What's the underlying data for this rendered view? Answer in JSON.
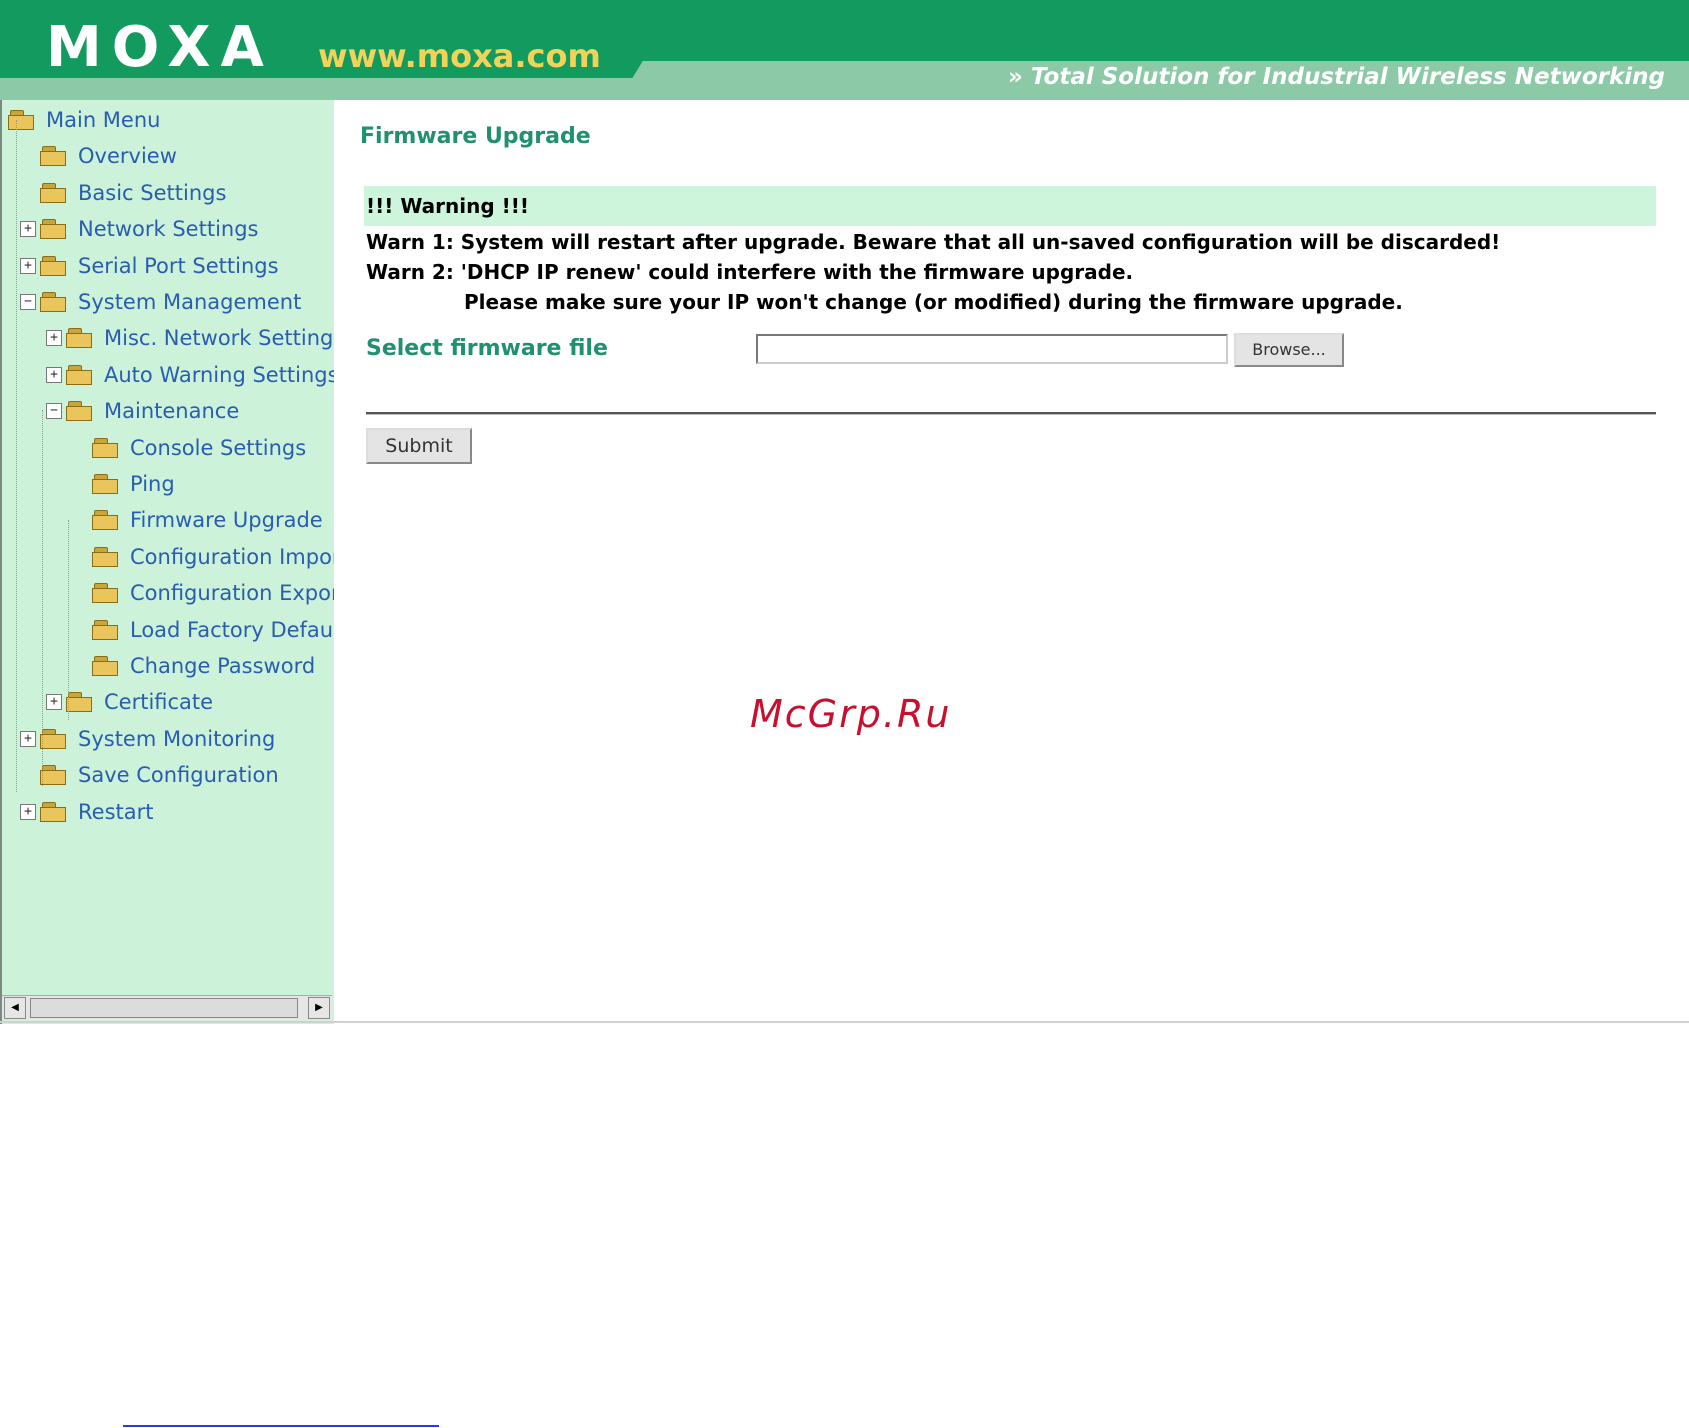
{
  "header": {
    "logo": "MOXA",
    "url": "www.moxa.com",
    "tagline_icon": "double-chevron-icon",
    "tagline": "Total Solution for Industrial Wireless Networking"
  },
  "sidebar": {
    "root": "Main Menu",
    "items": [
      {
        "label": "Overview",
        "depth": 1,
        "toggle": ""
      },
      {
        "label": "Basic Settings",
        "depth": 1,
        "toggle": ""
      },
      {
        "label": "Network Settings",
        "depth": 1,
        "toggle": "+"
      },
      {
        "label": "Serial Port Settings",
        "depth": 1,
        "toggle": "+"
      },
      {
        "label": "System Management",
        "depth": 1,
        "toggle": "-"
      },
      {
        "label": "Misc. Network Settings",
        "depth": 2,
        "toggle": "+"
      },
      {
        "label": "Auto Warning Settings",
        "depth": 2,
        "toggle": "+"
      },
      {
        "label": "Maintenance",
        "depth": 2,
        "toggle": "-"
      },
      {
        "label": "Console Settings",
        "depth": 3,
        "toggle": ""
      },
      {
        "label": "Ping",
        "depth": 3,
        "toggle": ""
      },
      {
        "label": "Firmware Upgrade",
        "depth": 3,
        "toggle": ""
      },
      {
        "label": "Configuration Import",
        "depth": 3,
        "toggle": ""
      },
      {
        "label": "Configuration Export",
        "depth": 3,
        "toggle": ""
      },
      {
        "label": "Load Factory Default",
        "depth": 3,
        "toggle": ""
      },
      {
        "label": "Change Password",
        "depth": 3,
        "toggle": ""
      },
      {
        "label": "Certificate",
        "depth": 2,
        "toggle": "+"
      },
      {
        "label": "System Monitoring",
        "depth": 1,
        "toggle": "+"
      },
      {
        "label": "Save Configuration",
        "depth": 1,
        "toggle": ""
      },
      {
        "label": "Restart",
        "depth": 1,
        "toggle": "+"
      }
    ]
  },
  "main": {
    "title": "Firmware Upgrade",
    "warning_title": "!!! Warning !!!",
    "warn1": "Warn 1: System will restart after upgrade. Beware that all un-saved configuration will be discarded!",
    "warn2": "Warn 2: 'DHCP IP renew' could interfere with the firmware upgrade.",
    "warn2b": "Please make sure your IP won't change (or modified) during the firmware upgrade.",
    "select_label": "Select firmware file",
    "file_value": "",
    "browse_label": "Browse...",
    "submit_label": "Submit"
  },
  "watermark": "McGrp.Ru",
  "colors": {
    "header_dark": "#139a5e",
    "header_light": "#8cc9a6",
    "sidebar_bg": "#ccf2d9",
    "link": "#2a5db0",
    "title_green": "#209070",
    "watermark": "#c8102e"
  }
}
